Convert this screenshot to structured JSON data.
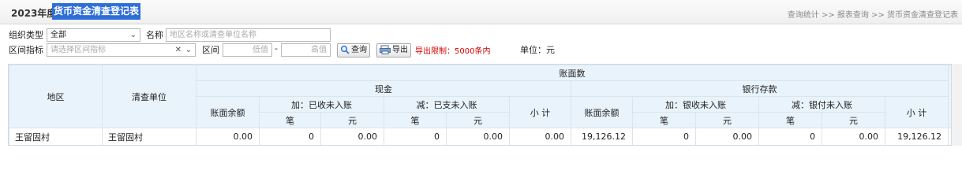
{
  "header": {
    "year": "2023年度",
    "title": "货币资金清查登记表",
    "breadcrumb": "查询统计 >> 报表查询 >> 货币资金清查登记表"
  },
  "filters": {
    "org_type_label": "组织类型",
    "org_type_value": "全部",
    "name_label": "名称",
    "name_placeholder": "地区名称或清查单位名称",
    "range_label": "区间指标",
    "range_placeholder": "请选择区间指标",
    "interval_label": "区间",
    "low_placeholder": "低值",
    "dash": "-",
    "high_placeholder": "高值",
    "query_button": "查询",
    "export_button": "导出",
    "export_limit": "导出限制：5000条内",
    "unit": "单位：元"
  },
  "table": {
    "headers": {
      "region": "地区",
      "unit": "清查单位",
      "book_amount": "账面数",
      "cash": "现金",
      "bank": "银行存款",
      "balance": "账面余额",
      "cash_add": "加：已收未入账",
      "cash_sub": "减：已支未入账",
      "bank_add": "加：银收未入账",
      "bank_sub": "减：银付未入账",
      "subtotal": "小 计",
      "count": "笔",
      "yuan": "元"
    },
    "rows": [
      {
        "region": "王留固村",
        "unit": "王留固村",
        "cash_balance": "0.00",
        "cash_add_count": "0",
        "cash_add_yuan": "0.00",
        "cash_sub_count": "0",
        "cash_sub_yuan": "0.00",
        "cash_subtotal": "0.00",
        "bank_balance": "19,126.12",
        "bank_add_count": "0",
        "bank_add_yuan": "0.00",
        "bank_sub_count": "0",
        "bank_sub_yuan": "0.00",
        "bank_subtotal": "19,126.12"
      }
    ]
  }
}
